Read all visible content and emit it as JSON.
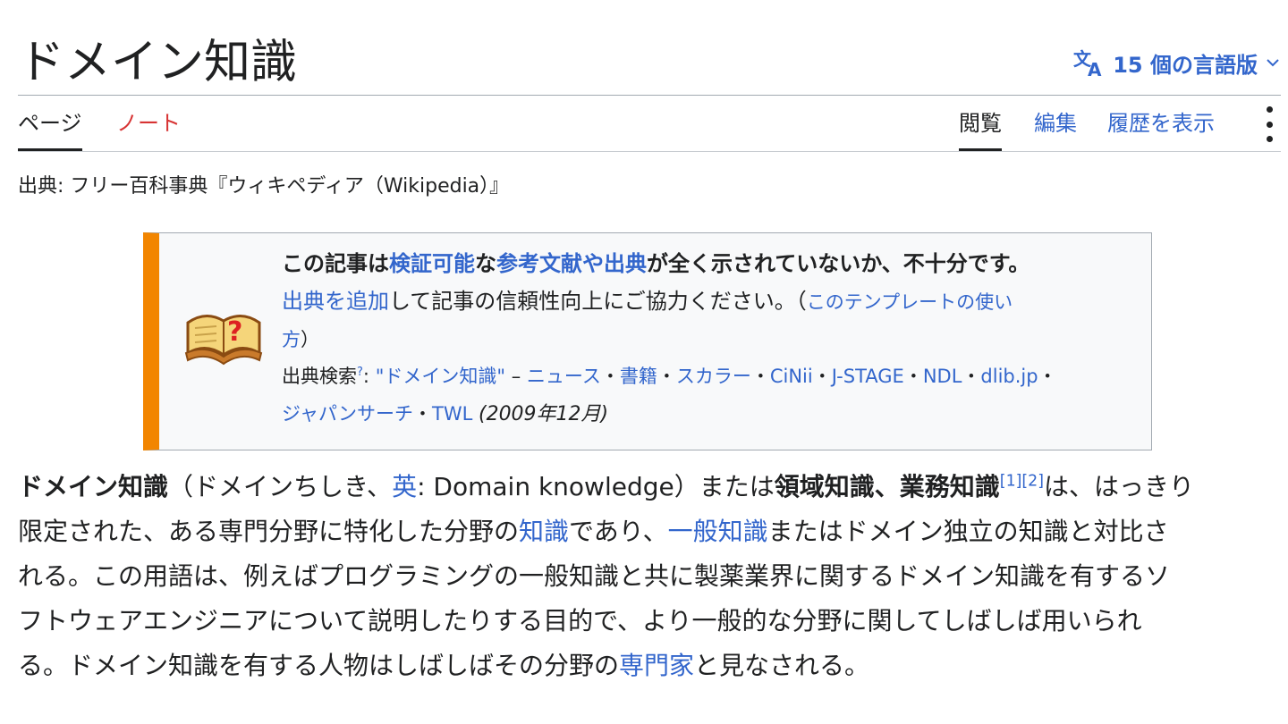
{
  "page_title": "ドメイン知識",
  "language_button": {
    "label": "15 個の言語版",
    "icon": "translate-icon",
    "chevron": "chevron-down-icon"
  },
  "tabs": {
    "page": "ページ",
    "talk": "ノート",
    "read": "閲覧",
    "edit": "編集",
    "history": "履歴を表示"
  },
  "more_menu_icon": "vertical-ellipsis-icon",
  "source_line": "出典: フリー百科事典『ウィキペディア（Wikipedia）』",
  "ambox": {
    "icon": "open-book-question-icon",
    "line1": {
      "t1": "この記事は",
      "link1": "検証可能",
      "t2": "な",
      "link2": "参考文献や出典",
      "t3": "が全く示されていないか、不十分です。"
    },
    "line2": {
      "link1": "出典を追加",
      "t1": "して記事の信頼性向上にご協力ください。（",
      "link2": "このテンプレートの使い"
    },
    "line3": {
      "link": "方",
      "t1": "）"
    },
    "line4": {
      "label": "出典検索",
      "sup": "?",
      "t1": ": ",
      "query_link": "\"ドメイン知識\"",
      "dash": " – ",
      "news": "ニュース",
      "books": "書籍",
      "scholar": "スカラー",
      "cinii": "CiNii",
      "jstage": "J-STAGE",
      "ndl": "NDL",
      "dlib": "dlib.jp",
      "sep": "・"
    },
    "line5": {
      "japansearch": "ジャパンサーチ",
      "sep": "・",
      "twl": "TWL",
      "date": "(2009年12月)"
    }
  },
  "article": {
    "line1": {
      "bold1": "ドメイン知識",
      "t1": "（ドメインちしき、",
      "link_en": "英",
      "t2": ": Domain knowledge）または",
      "bold2": "領域知識",
      "t3": "、",
      "bold3": "業務知識",
      "ref1": "[1]",
      "ref2": "[2]",
      "t4": "は、はっきり"
    },
    "line2": {
      "t1": "限定された、ある専門分野に特化した分野の",
      "link1": "知識",
      "t2": "であり、",
      "link2": "一般知識",
      "t3": "またはドメイン独立の知識と対比さ"
    },
    "line3": "れる。この用語は、例えばプログラミングの一般知識と共に製薬業界に関するドメイン知識を有するソ",
    "line4": "フトウェアエンジニアについて説明したりする目的で、より一般的な分野に関してしばしば用いられ",
    "line5": {
      "t1": "る。ドメイン知識を有する人物はしばしばその分野の",
      "link1": "専門家",
      "t2": "と見なされる。"
    }
  },
  "colors": {
    "link": "#3366cc",
    "talk_red": "#d73333",
    "ambox_stripe": "#f28500",
    "text": "#202122"
  }
}
